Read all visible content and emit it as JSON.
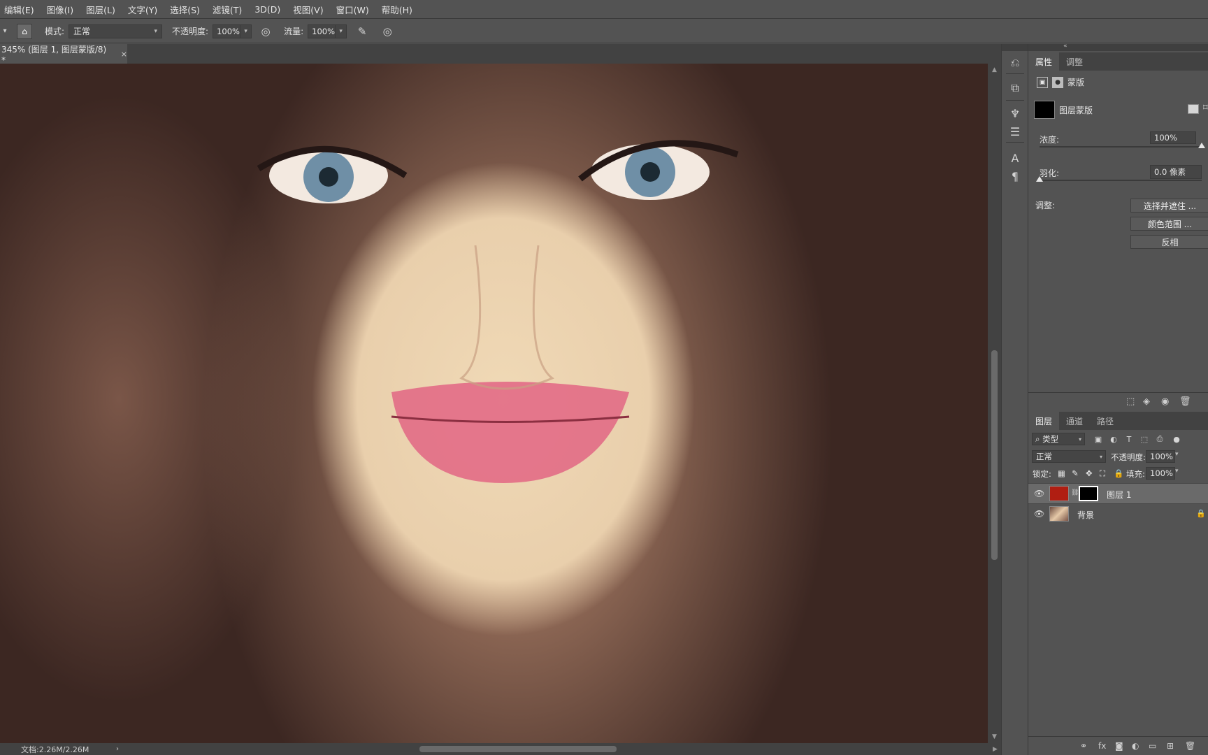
{
  "menu": [
    "编辑(E)",
    "图像(I)",
    "图层(L)",
    "文字(Y)",
    "选择(S)",
    "滤镜(T)",
    "3D(D)",
    "视图(V)",
    "窗口(W)",
    "帮助(H)"
  ],
  "options": {
    "mode_label": "模式:",
    "mode_value": "正常",
    "opacity_label": "不透明度:",
    "opacity_value": "100%",
    "flow_label": "流量:",
    "flow_value": "100%"
  },
  "document_tab": {
    "title": "345% (图层 1, 图层蒙版/8) *",
    "close": "×"
  },
  "status": {
    "doc_size": "文档:2.26M/2.26M",
    "arrow": "›"
  },
  "properties": {
    "tabs": [
      "属性",
      "调整"
    ],
    "mask_type": "蒙版",
    "layer_mask_label": "图层蒙版",
    "density_label": "浓度:",
    "density_value": "100%",
    "feather_label": "羽化:",
    "feather_value": "0.0 像素",
    "density_level": 1.0,
    "feather_level": 0.0,
    "adjust_label": "调整:",
    "btn_select_mask": "选择并遮住 ...",
    "btn_color_range": "颜色范围 ...",
    "btn_invert": "反相"
  },
  "layers_panel": {
    "tabs": [
      "图层",
      "通道",
      "路径"
    ],
    "filter_kind": "类型",
    "blend_mode": "正常",
    "opacity_label": "不透明度:",
    "opacity_value": "100%",
    "lock_label": "锁定:",
    "fill_label": "填充:",
    "fill_value": "100%",
    "layers": [
      {
        "name": "图层 1",
        "selected": true,
        "thumb_color": "#b01e12"
      },
      {
        "name": "背景",
        "selected": false,
        "locked": true
      }
    ]
  },
  "colors": {
    "panel": "#535353",
    "dark": "#424242",
    "layer_red": "#b01e12"
  }
}
